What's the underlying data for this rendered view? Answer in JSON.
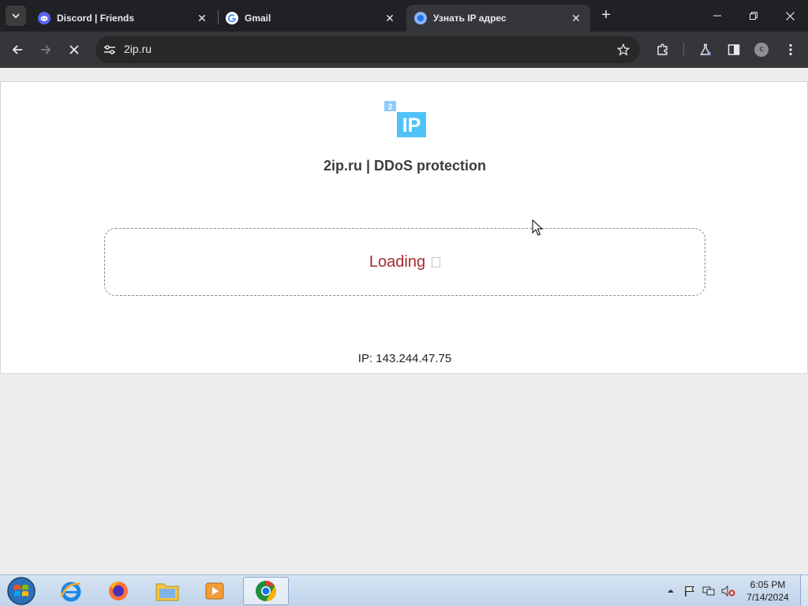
{
  "browser": {
    "tabs": [
      {
        "title": "Discord | Friends",
        "favicon": "discord-icon",
        "active": false
      },
      {
        "title": "Gmail",
        "favicon": "google-icon",
        "active": false
      },
      {
        "title": "Узнать IP адрес",
        "favicon": "2ip-icon",
        "active": true
      }
    ],
    "new_tab_label": "+",
    "address": "2ip.ru",
    "account_initial": "c"
  },
  "page": {
    "logo": {
      "badge": "2",
      "letters": "IP"
    },
    "title": "2ip.ru | DDoS protection",
    "loading_text": "Loading",
    "ip_line": "IP: 143.244.47.75"
  },
  "colors": {
    "loading_text": "#a52a2a",
    "logo_blue": "#4fc3f7",
    "logo_badge": "#90caf9"
  },
  "taskbar": {
    "apps": [
      "internet-explorer-icon",
      "firefox-icon",
      "file-explorer-icon",
      "media-player-icon",
      "chrome-icon"
    ],
    "time": "6:05 PM",
    "date": "7/14/2024"
  }
}
